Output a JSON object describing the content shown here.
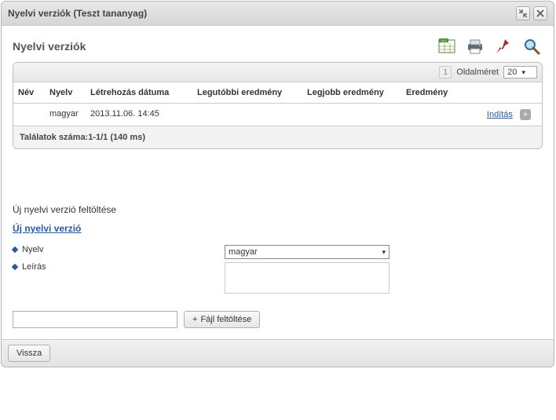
{
  "titlebar": {
    "title": "Nyelvi verziók (Teszt tananyag)"
  },
  "panel": {
    "title": "Nyelvi verziók"
  },
  "pager": {
    "page": "1",
    "page_size_label": "Oldalméret",
    "page_size_value": "20"
  },
  "columns": {
    "name": "Név",
    "language": "Nyelv",
    "created": "Létrehozás dátuma",
    "last_result": "Legutóbbi eredmény",
    "best_result": "Legjobb eredmény",
    "result": "Eredmény"
  },
  "rows": [
    {
      "name": "",
      "language": "magyar",
      "created": "2013.11.06. 14:45",
      "last_result": "",
      "best_result": "",
      "result": "",
      "action": "Indítás"
    }
  ],
  "grid_footer": "Találatok száma:1-1/1 (140 ms)",
  "upload": {
    "caption": "Új nyelvi verzió feltöltése",
    "link": "Új nyelvi verzió",
    "lang_label": "Nyelv",
    "desc_label": "Leírás",
    "lang_value": "magyar",
    "file_value": "",
    "upload_btn": "Fájl feltöltése"
  },
  "footer": {
    "back": "Vissza"
  }
}
